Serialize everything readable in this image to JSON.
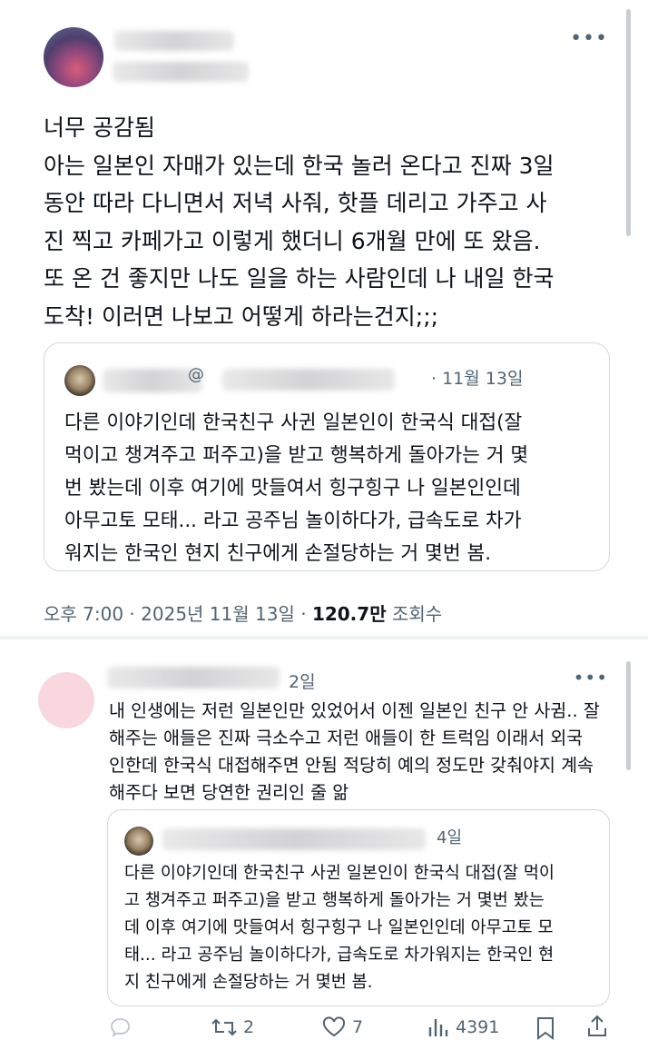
{
  "post": {
    "lines": [
      "너무 공감됨",
      "아는 일본인 자매가 있는데 한국 놀러 온다고 진짜 3일",
      "동안 따라 다니면서 저녁 사줘, 핫플 데리고 가주고 사",
      "진 찍고 카페가고 이렇게 했더니 6개월 만에 또 왔음.",
      "또 온 건 좋지만 나도 일을 하는 사람인데 나 내일 한국",
      "도착! 이러면 나보고 어떻게 하라는건지;;;"
    ],
    "quote": {
      "handle": "@",
      "date": "· 11월 13일",
      "lines": [
        "다른 이야기인데 한국친구 사귄 일본인이 한국식 대접(잘",
        "먹이고 챙겨주고 퍼주고)을 받고 행복하게 돌아가는 거 몇",
        "번 봤는데 이후 여기에 맛들여서 힝구힝구 나 일본인인데",
        "아무고토 모태... 라고 공주님 놀이하다가, 급속도로 차가",
        "워지는 한국인 현지 친구에게 손절당하는 거 몇번 봄."
      ]
    },
    "meta": {
      "time": "오후 7:00 · 2025년 11월 13일 · ",
      "views": "120.7만",
      "views_label": " 조회수"
    }
  },
  "reply": {
    "time": "2일",
    "lines": [
      "내 인생에는 저런 일본인만 있었어서 이젠 일본인 친구 안 사귐.. 잘",
      "해주는 애들은 진짜 극소수고 저런 애들이 한 트럭임 이래서 외국",
      "인한데 한국식 대접해주면 안됨 적당히 예의 정도만 갖춰야지 계속",
      "해주다 보면 당연한 권리인 줄 앎"
    ],
    "quote": {
      "date": "4일",
      "lines": [
        "다른 이야기인데 한국친구 사귄 일본인이 한국식 대접(잘 먹이",
        "고 챙겨주고 퍼주고)을 받고 행복하게 돌아가는 거 몇번 봤는",
        "데 이후 여기에 맛들여서 힝구힝구 나 일본인인데 아무고토 모",
        "태... 라고 공주님 놀이하다가, 급속도로 차가워지는 한국인 현",
        "지 친구에게 손절당하는 거 몇번 봄."
      ]
    },
    "actions": {
      "retweets": "2",
      "likes": "7",
      "views": "4391"
    }
  }
}
